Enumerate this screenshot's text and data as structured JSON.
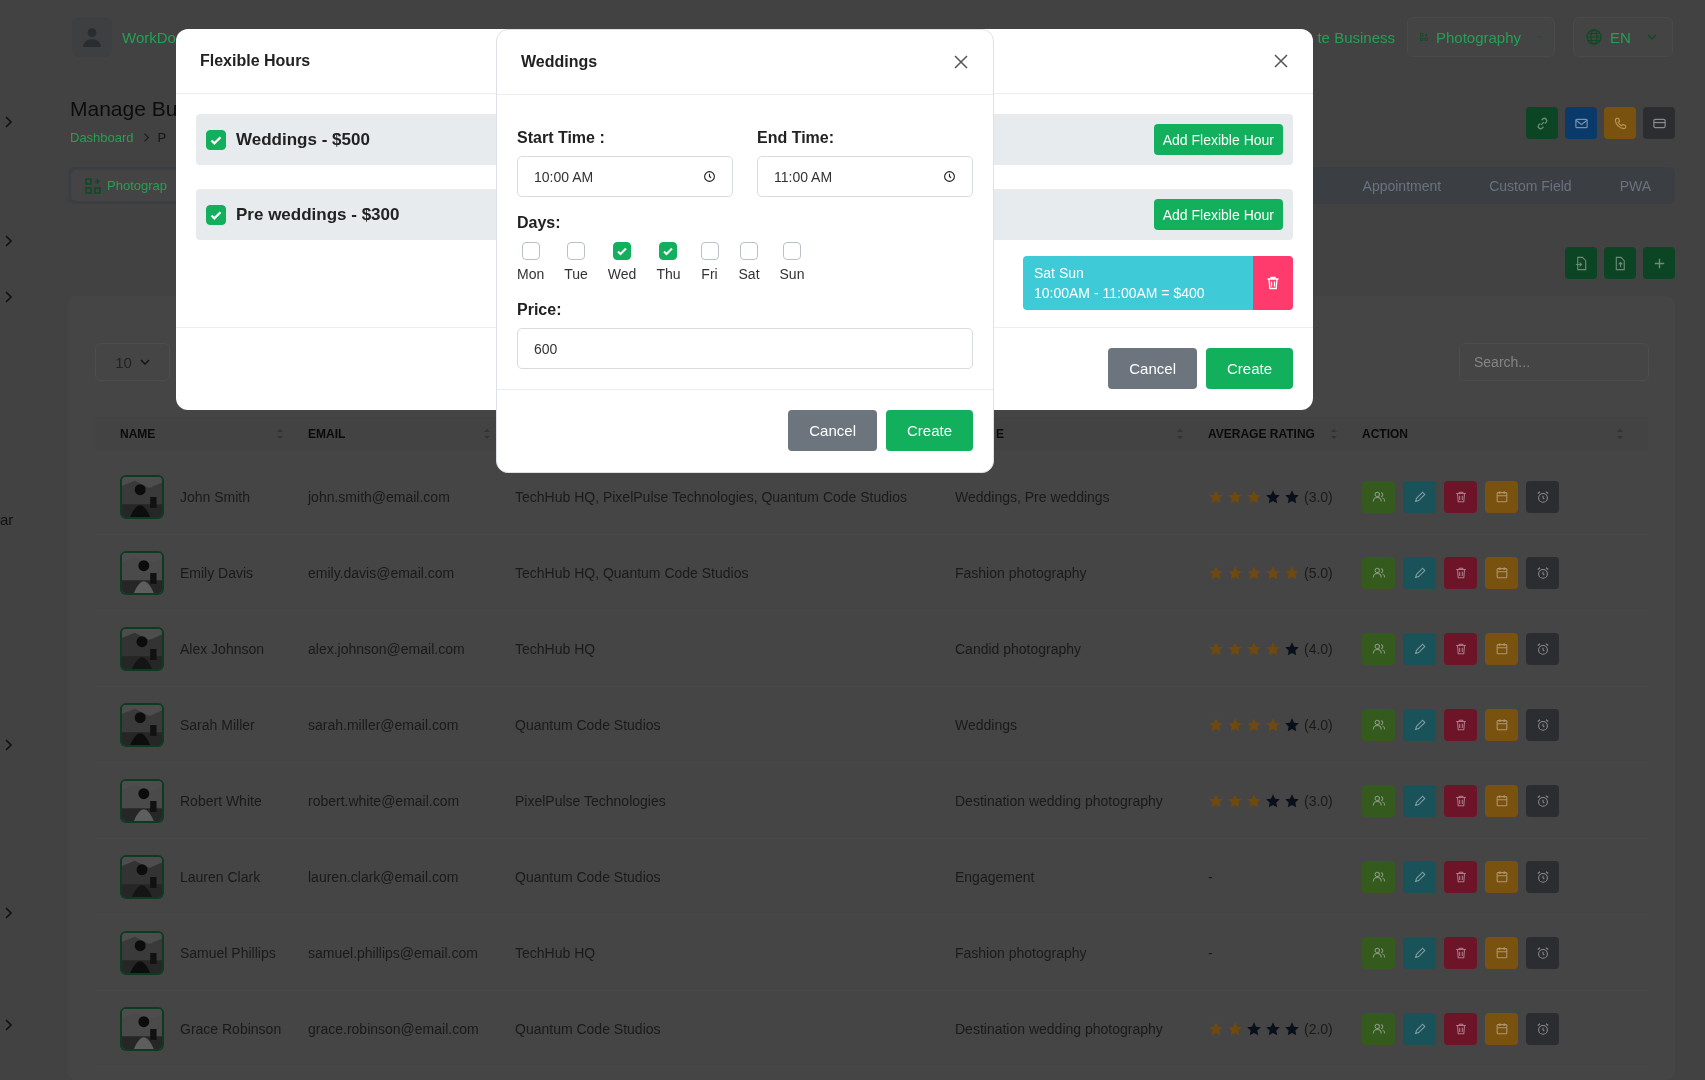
{
  "sidebar": {
    "items": [
      {
        "kind": "chevron"
      },
      {
        "kind": "chevron"
      },
      {
        "kind": "chevron"
      },
      {
        "kind": "text",
        "label": "ar"
      },
      {
        "kind": "chevron"
      },
      {
        "kind": "chevron"
      },
      {
        "kind": "chevron"
      }
    ]
  },
  "header": {
    "brand": "WorkDo",
    "business": "te Business",
    "workspace": "Photography",
    "language": "EN"
  },
  "page": {
    "title": "Manage Bu",
    "breadcrumb": [
      "Dashboard",
      "P"
    ]
  },
  "tabs": [
    {
      "label": "Photograp",
      "selected": true
    },
    {
      "label": "Appointment",
      "selected": false
    },
    {
      "label": "Custom Field",
      "selected": false
    },
    {
      "label": "PWA",
      "selected": false
    }
  ],
  "table": {
    "page_size": "10",
    "search_placeholder": "Search...",
    "columns": [
      {
        "label": "NAME"
      },
      {
        "label": "EMAIL"
      },
      {
        "label": "E"
      },
      {
        "label": "AVERAGE RATING"
      },
      {
        "label": "ACTION"
      }
    ],
    "rows": [
      {
        "name": "John Smith",
        "email": "john.smith@email.com",
        "companies": "TechHub HQ, PixelPulse Technologies, Quantum Code Studios",
        "services": "Weddings, Pre weddings",
        "stars": 3,
        "rating": "(3.0)"
      },
      {
        "name": "Emily Davis",
        "email": "emily.davis@email.com",
        "companies": "TechHub HQ, Quantum Code Studios",
        "services": "Fashion photography",
        "stars": 5,
        "rating": "(5.0)"
      },
      {
        "name": "Alex Johnson",
        "email": "alex.johnson@email.com",
        "companies": "TechHub HQ",
        "services": "Candid photography",
        "stars": 4,
        "rating": "(4.0)"
      },
      {
        "name": "Sarah Miller",
        "email": "sarah.miller@email.com",
        "companies": "Quantum Code Studios",
        "services": "Weddings",
        "stars": 4,
        "rating": "(4.0)"
      },
      {
        "name": "Robert White",
        "email": "robert.white@email.com",
        "companies": "PixelPulse Technologies",
        "services": "Destination wedding photography",
        "stars": 3,
        "rating": "(3.0)"
      },
      {
        "name": "Lauren Clark",
        "email": "lauren.clark@email.com",
        "companies": "Quantum Code Studios",
        "services": "Engagement",
        "rating": "-"
      },
      {
        "name": "Samuel Phillips",
        "email": "samuel.phillips@email.com",
        "companies": "TechHub HQ",
        "services": "Fashion photography",
        "rating": "-"
      },
      {
        "name": "Grace Robinson",
        "email": "grace.robinson@email.com",
        "companies": "Quantum Code Studios",
        "services": "Destination wedding photography",
        "stars": 2,
        "rating": "(2.0)"
      }
    ]
  },
  "flexible_hours_modal": {
    "title": "Flexible Hours",
    "services": [
      {
        "label": "Weddings - $500",
        "checked": true,
        "button": "Add Flexible Hour"
      },
      {
        "label": "Pre weddings - $300",
        "checked": true,
        "button": "Add Flexible Hour",
        "slots": [
          {
            "days": "Sat Sun",
            "time": "10:00AM - 11:00AM = $400"
          }
        ]
      }
    ],
    "buttons": [
      {
        "label": "Cancel",
        "kind": "secondary"
      },
      {
        "label": "Create",
        "kind": "primary"
      }
    ]
  },
  "weddings_modal": {
    "title": "Weddings",
    "start_time": {
      "label": "Start Time :",
      "value": "10:00 AM"
    },
    "end_time": {
      "label": "End Time:",
      "value": "11:00 AM"
    },
    "days_label": "Days:",
    "days": [
      {
        "label": "Mon",
        "checked": false
      },
      {
        "label": "Tue",
        "checked": false
      },
      {
        "label": "Wed",
        "checked": true
      },
      {
        "label": "Thu",
        "checked": true
      },
      {
        "label": "Fri",
        "checked": false
      },
      {
        "label": "Sat",
        "checked": false
      },
      {
        "label": "Sun",
        "checked": false
      }
    ],
    "price": {
      "label": "Price:",
      "value": "600"
    },
    "buttons": [
      {
        "label": "Cancel",
        "kind": "secondary"
      },
      {
        "label": "Create",
        "kind": "primary"
      }
    ]
  }
}
